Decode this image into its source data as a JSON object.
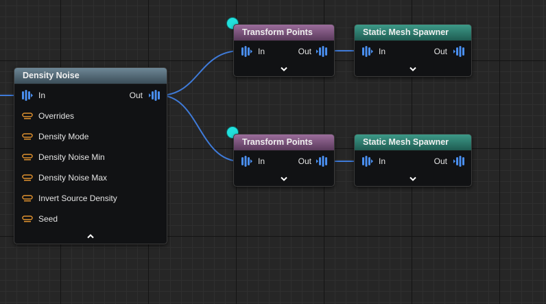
{
  "nodes": {
    "density_noise": {
      "title": "Density Noise",
      "in_label": "In",
      "out_label": "Out",
      "params": [
        "Overrides",
        "Density Mode",
        "Density Noise Min",
        "Density Noise Max",
        "Invert Source Density",
        "Seed"
      ],
      "chevron_icon": "chevron-up-icon"
    },
    "transform_points_1": {
      "title": "Transform Points",
      "in_label": "In",
      "out_label": "Out",
      "chevron_icon": "chevron-down-icon"
    },
    "transform_points_2": {
      "title": "Transform Points",
      "in_label": "In",
      "out_label": "Out",
      "chevron_icon": "chevron-down-icon"
    },
    "static_mesh_spawner_1": {
      "title": "Static Mesh Spawner",
      "in_label": "In",
      "out_label": "Out",
      "chevron_icon": "chevron-down-icon"
    },
    "static_mesh_spawner_2": {
      "title": "Static Mesh Spawner",
      "in_label": "In",
      "out_label": "Out",
      "chevron_icon": "chevron-down-icon"
    }
  },
  "colors": {
    "canvas_bg": "#262626",
    "wire": "#3f7bd9",
    "pin": "#4a8ff0",
    "param_pin": "#e0912e",
    "density_header": "#5a7584",
    "transform_header": "#7e5380",
    "spawner_header": "#2e7d6f",
    "exec_dot": "#22e0dc"
  }
}
